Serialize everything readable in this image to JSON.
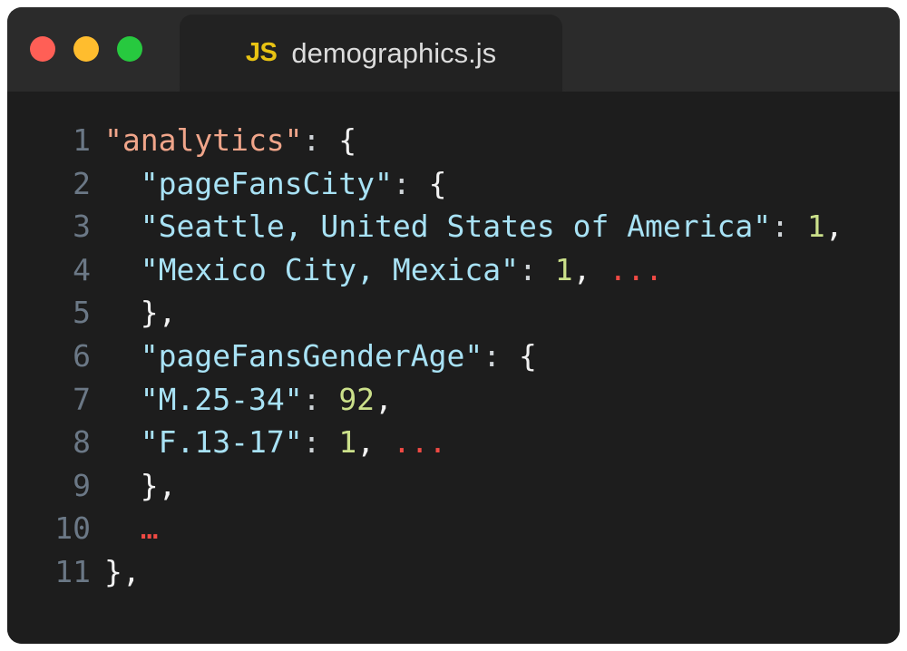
{
  "window": {
    "background_color": "#1d1d1d",
    "titlebar_color": "#2b2b2b",
    "tab_color": "#222222"
  },
  "titlebar": {
    "traffic_lights": [
      {
        "name": "close",
        "color": "#ff5f56"
      },
      {
        "name": "minimize",
        "color": "#ffbd2e"
      },
      {
        "name": "maximize",
        "color": "#27c93f"
      }
    ],
    "tab": {
      "icon_label": "JS",
      "icon_color": "#e8c313",
      "filename": "demographics.js"
    }
  },
  "editor": {
    "language": "json",
    "colors": {
      "root_key": "#f0a58a",
      "key": "#a8e2f5",
      "number": "#cbe08a",
      "punctuation": "#f2f2f2",
      "colon": "#cfd4d8",
      "ellipsis": "#f04a44",
      "line_number": "#6b7886"
    },
    "lines": [
      {
        "number": "1",
        "indent": 0,
        "tokens": [
          {
            "t": "\"analytics\"",
            "c": "tok-key-root"
          },
          {
            "t": ":",
            "c": "tok-colon"
          },
          {
            "t": " ",
            "c": "tok-punc"
          },
          {
            "t": "{",
            "c": "tok-punc"
          }
        ]
      },
      {
        "number": "2",
        "indent": 2,
        "tokens": [
          {
            "t": "\"pageFansCity\"",
            "c": "tok-key"
          },
          {
            "t": ":",
            "c": "tok-colon"
          },
          {
            "t": " ",
            "c": "tok-punc"
          },
          {
            "t": "{",
            "c": "tok-punc"
          }
        ]
      },
      {
        "number": "3",
        "indent": 2,
        "tokens": [
          {
            "t": "\"Seattle, United States of America\"",
            "c": "tok-key"
          },
          {
            "t": ":",
            "c": "tok-colon"
          },
          {
            "t": " ",
            "c": "tok-punc"
          },
          {
            "t": "1",
            "c": "tok-num"
          },
          {
            "t": ",",
            "c": "tok-punc"
          }
        ]
      },
      {
        "number": "4",
        "indent": 2,
        "tokens": [
          {
            "t": "\"Mexico City, Mexica\"",
            "c": "tok-key"
          },
          {
            "t": ":",
            "c": "tok-colon"
          },
          {
            "t": " ",
            "c": "tok-punc"
          },
          {
            "t": "1",
            "c": "tok-num"
          },
          {
            "t": ", ",
            "c": "tok-punc"
          },
          {
            "t": "...",
            "c": "tok-dots"
          }
        ]
      },
      {
        "number": "5",
        "indent": 2,
        "tokens": [
          {
            "t": "}",
            "c": "tok-punc"
          },
          {
            "t": ",",
            "c": "tok-punc"
          }
        ]
      },
      {
        "number": "6",
        "indent": 2,
        "tokens": [
          {
            "t": "\"pageFansGenderAge\"",
            "c": "tok-key"
          },
          {
            "t": ":",
            "c": "tok-colon"
          },
          {
            "t": " ",
            "c": "tok-punc"
          },
          {
            "t": "{",
            "c": "tok-punc"
          }
        ]
      },
      {
        "number": "7",
        "indent": 2,
        "tokens": [
          {
            "t": "\"M.25-34\"",
            "c": "tok-key"
          },
          {
            "t": ":",
            "c": "tok-colon"
          },
          {
            "t": " ",
            "c": "tok-punc"
          },
          {
            "t": "92",
            "c": "tok-num"
          },
          {
            "t": ",",
            "c": "tok-punc"
          }
        ]
      },
      {
        "number": "8",
        "indent": 2,
        "tokens": [
          {
            "t": "\"F.13-17\"",
            "c": "tok-key"
          },
          {
            "t": ":",
            "c": "tok-colon"
          },
          {
            "t": " ",
            "c": "tok-punc"
          },
          {
            "t": "1",
            "c": "tok-num"
          },
          {
            "t": ", ",
            "c": "tok-punc"
          },
          {
            "t": "...",
            "c": "tok-dots"
          }
        ]
      },
      {
        "number": "9",
        "indent": 2,
        "tokens": [
          {
            "t": "}",
            "c": "tok-punc"
          },
          {
            "t": ",",
            "c": "tok-punc"
          }
        ]
      },
      {
        "number": "10",
        "indent": 2,
        "tokens": [
          {
            "t": "…",
            "c": "tok-ellipsis"
          }
        ]
      },
      {
        "number": "11",
        "indent": 0,
        "tokens": [
          {
            "t": "}",
            "c": "tok-punc"
          },
          {
            "t": ",",
            "c": "tok-punc"
          }
        ]
      }
    ]
  }
}
